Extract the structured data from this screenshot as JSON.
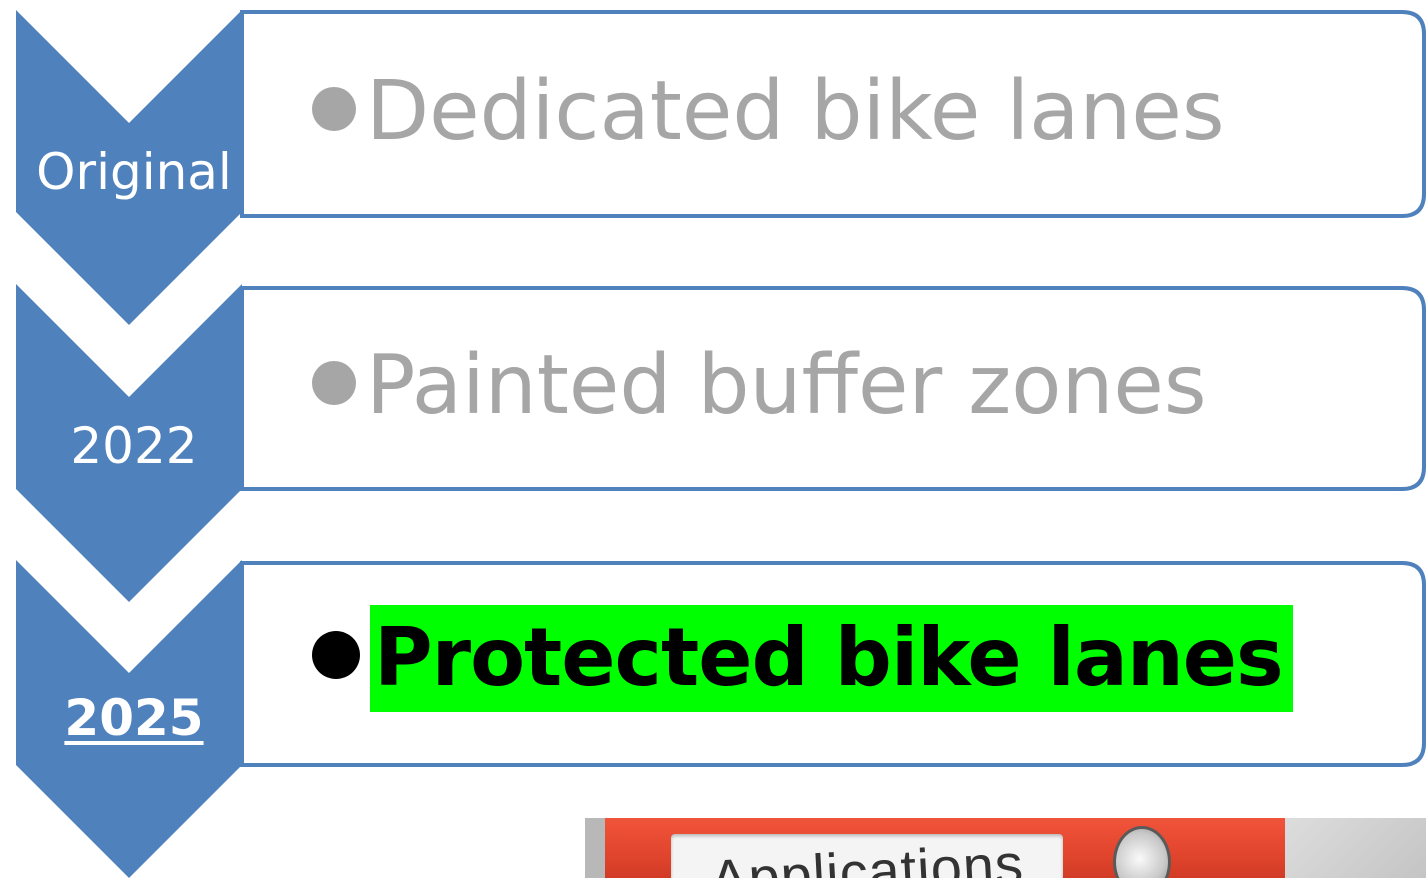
{
  "process": {
    "steps": [
      {
        "label": "Original",
        "text": "Dedicated bike lanes",
        "emphasis": false
      },
      {
        "label": "2022",
        "text": "Painted buffer zones",
        "emphasis": false
      },
      {
        "label": "2025",
        "text": "Protected bike lanes",
        "emphasis": true
      }
    ]
  },
  "photo": {
    "label_text": "Applications"
  },
  "colors": {
    "chevron_fill": "#4f81bd",
    "card_border": "#4f81bd",
    "muted_text": "#a6a6a6",
    "highlight": "#00ff00",
    "binder": "#e8492f"
  }
}
